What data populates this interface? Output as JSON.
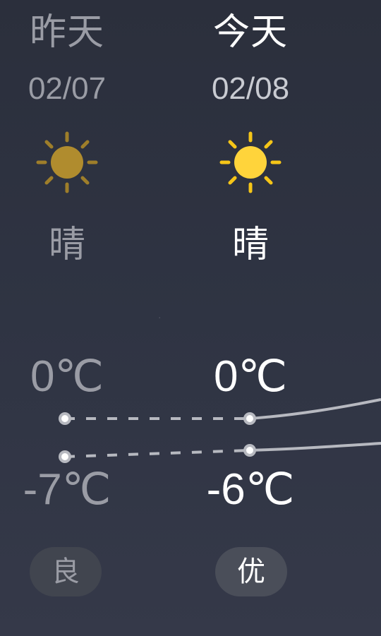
{
  "days": [
    {
      "label": "昨天",
      "date": "02/07",
      "condition": "晴",
      "high": "0℃",
      "low": "-7℃",
      "aqi": "良",
      "icon": "sun-icon"
    },
    {
      "label": "今天",
      "date": "02/08",
      "condition": "晴",
      "high": "0℃",
      "low": "-6℃",
      "aqi": "优",
      "icon": "sun-icon"
    }
  ],
  "colors": {
    "background": "#2b2f3c",
    "active_text": "#ffffff",
    "past_text": "#9a9ca5",
    "sun_past": "#b08c2e",
    "sun_today": "#ffd43b",
    "ray_past": "#9e7e2a",
    "ray_today": "#f5c518",
    "temp_line": "#b7b9c0",
    "aqi_pill_past": "#41454f",
    "aqi_pill_today": "#4a4e59"
  }
}
